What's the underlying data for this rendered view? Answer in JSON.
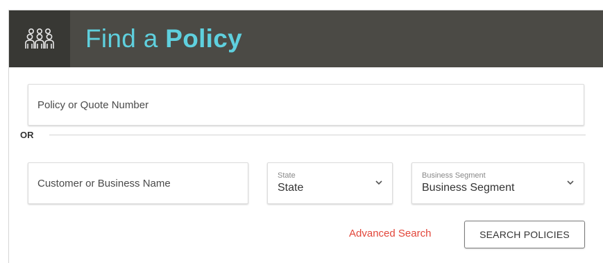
{
  "header": {
    "title_regular": "Find a ",
    "title_bold": "Policy",
    "icon": "group-of-people-icon"
  },
  "policy_field": {
    "placeholder": "Policy or Quote Number",
    "value": ""
  },
  "divider": {
    "label": "OR"
  },
  "customer_field": {
    "placeholder": "Customer or Business Name",
    "value": ""
  },
  "state_select": {
    "label": "State",
    "value": "State",
    "icon": "chevron-down-icon"
  },
  "segment_select": {
    "label": "Business Segment",
    "value": "Business Segment",
    "icon": "chevron-down-icon"
  },
  "actions": {
    "advanced_search": "Advanced Search",
    "search_button": "SEARCH POLICIES"
  },
  "colors": {
    "header_bg": "#4b4a45",
    "header_icon_bg": "#383834",
    "title_accent": "#5fd0de",
    "link": "#e2463a"
  }
}
